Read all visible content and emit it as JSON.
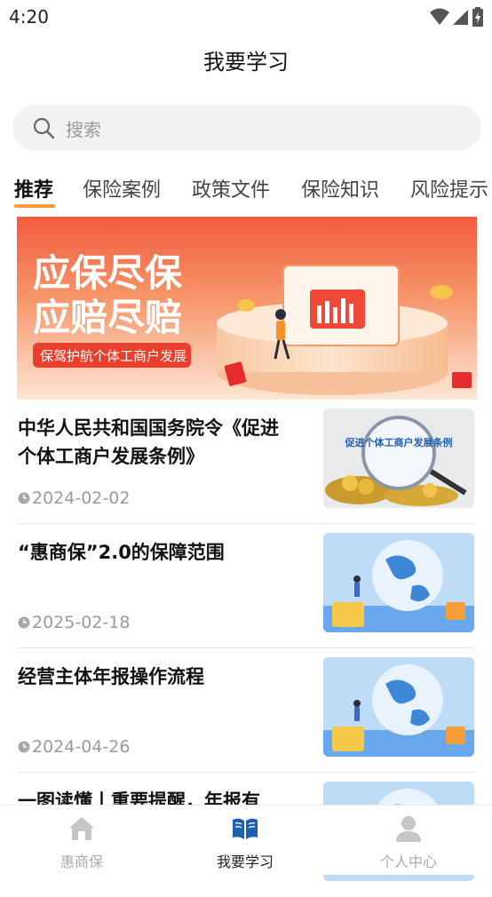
{
  "status_bar": {
    "time": "4:20"
  },
  "header": {
    "title": "我要学习"
  },
  "search": {
    "placeholder": "搜索"
  },
  "tabs": [
    {
      "label": "推荐",
      "active": true
    },
    {
      "label": "保险案例"
    },
    {
      "label": "政策文件"
    },
    {
      "label": "保险知识"
    },
    {
      "label": "风险提示"
    }
  ],
  "banner": {
    "line1": "应保尽保",
    "line2": "应赔尽赔",
    "tagline": "保驾护航个体工商户发展"
  },
  "articles": [
    {
      "title": "中华人民共和国国务院令《促进个体工商户发展条例》",
      "date": "2024-02-02",
      "thumb_caption": "促进个体工商户发展条例"
    },
    {
      "title": "“惠商保”2.0的保障范围",
      "date": "2025-02-18"
    },
    {
      "title": "经营主体年报操作流程",
      "date": "2024-04-26"
    },
    {
      "title": "一图读懂丨重要提醒，年报有"
    }
  ],
  "bottom_nav": [
    {
      "label": "惠商保",
      "icon": "home-icon"
    },
    {
      "label": "我要学习",
      "icon": "book-icon",
      "active": true
    },
    {
      "label": "个人中心",
      "icon": "person-icon"
    }
  ],
  "colors": {
    "accent": "#f39a3a",
    "nav_active": "#1f5fb0",
    "banner_red": "#f0453a"
  }
}
